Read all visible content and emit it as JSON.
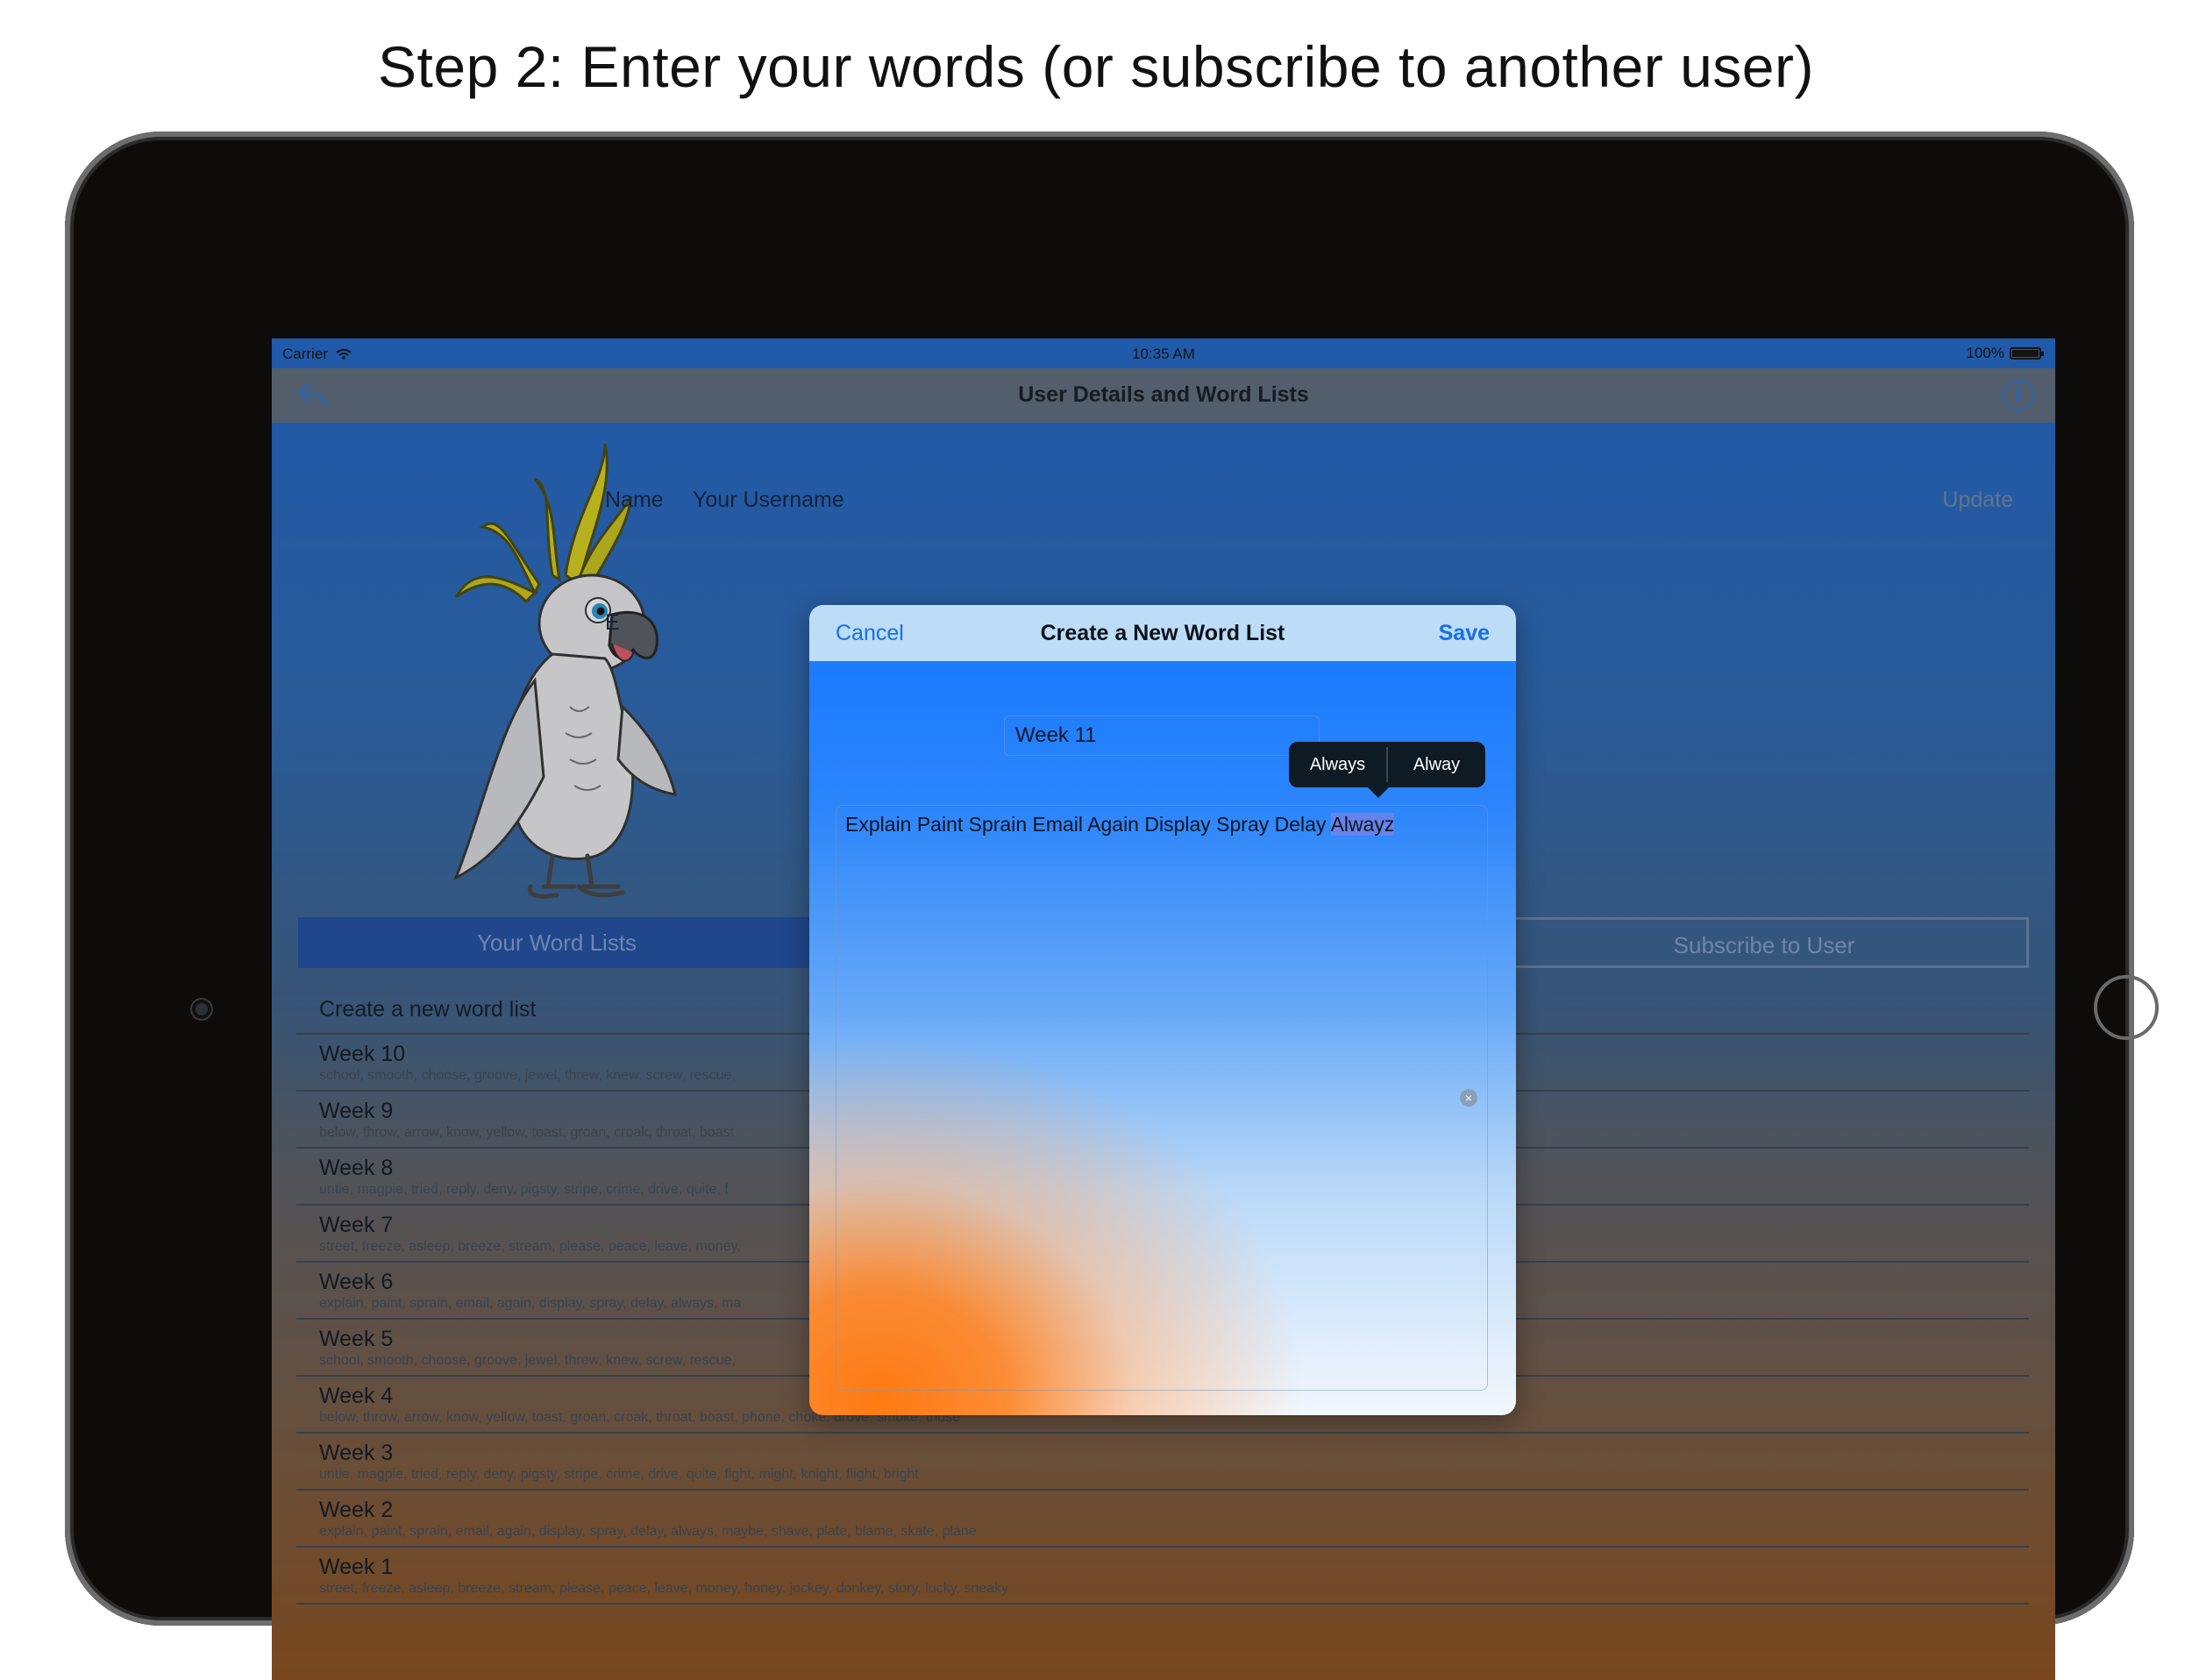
{
  "caption": "Step 2: Enter your words (or subscribe to another user)",
  "status_bar": {
    "carrier": "Carrier",
    "time": "10:35 AM",
    "battery": "100%"
  },
  "navbar": {
    "title": "User Details and Word Lists"
  },
  "user_details": {
    "name_label": "Name",
    "name_value": "Your Username",
    "update_label": "Update",
    "email_label_partial": "E"
  },
  "segments": {
    "left": "Your Word Lists",
    "right": "Subscribe to User"
  },
  "word_lists": {
    "create_label": "Create a new word list",
    "items": [
      {
        "title": "Week 10",
        "words": "school, smooth, choose, groove, jewel, threw, knew, screw, rescue,"
      },
      {
        "title": "Week 9",
        "words": "below, throw, arrow, know, yellow, toast, groan, croak, throat, boast"
      },
      {
        "title": "Week 8",
        "words": "untie, magpie, tried, reply, deny, pigsty, stripe, crime, drive, quite, f"
      },
      {
        "title": "Week 7",
        "words": "street, freeze, asleep, breeze, stream, please, peace, leave, money,"
      },
      {
        "title": "Week 6",
        "words": "explain, paint, sprain, email, again, display, spray, delay, always, ma"
      },
      {
        "title": "Week 5",
        "words": "school, smooth, choose, groove, jewel, threw, knew, screw, rescue,"
      },
      {
        "title": "Week 4",
        "words": "below, throw, arrow, know, yellow, toast, groan, croak, throat, boast, phone, choke, drove, smoke, those"
      },
      {
        "title": "Week 3",
        "words": "untie, magpie, tried, reply, deny, pigsty, stripe, crime, drive, quite, fight, might, knight, flight, bright"
      },
      {
        "title": "Week 2",
        "words": "explain, paint, sprain, email, again, display, spray, delay, always, maybe, shave, plate, blame, skate, plane"
      },
      {
        "title": "Week 1",
        "words": "street, freeze, asleep, breeze, stream, please, peace, leave, money, honey, jockey, donkey, story, lucky, sneaky"
      }
    ]
  },
  "modal": {
    "cancel": "Cancel",
    "title": "Create a New Word List",
    "save": "Save",
    "list_name": "Week 11",
    "words_text": "Explain Paint Sprain Email Again Display Spray Delay ",
    "highlighted_word": "Alwayz",
    "suggestions": [
      "Always",
      "Alway"
    ],
    "clear_glyph": "×"
  },
  "colors": {
    "accent": "#1670e6",
    "modal_header": "#bcdcf7",
    "suggest_bg": "#0e1a24"
  }
}
